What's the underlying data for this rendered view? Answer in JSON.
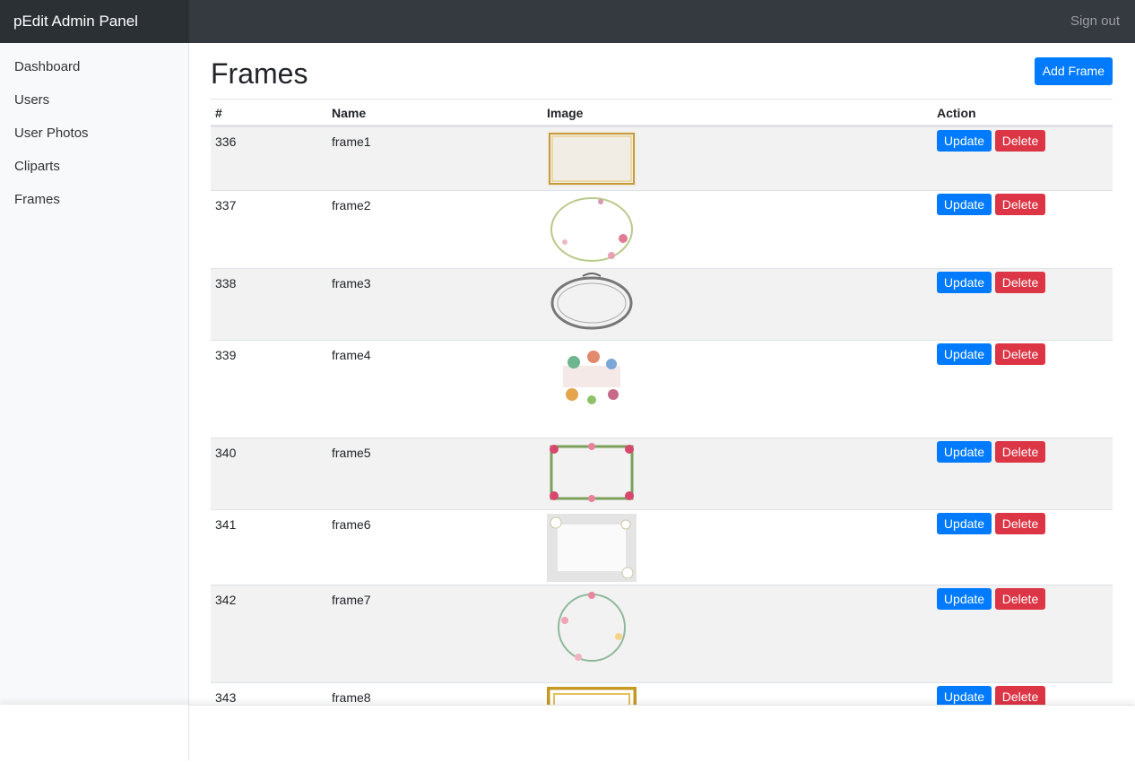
{
  "header": {
    "brand": "pEdit Admin Panel",
    "signout": "Sign out"
  },
  "sidebar": {
    "items": [
      {
        "label": "Dashboard"
      },
      {
        "label": "Users"
      },
      {
        "label": "User Photos"
      },
      {
        "label": "Cliparts"
      },
      {
        "label": "Frames"
      }
    ]
  },
  "page": {
    "title": "Frames",
    "add_button": "Add Frame"
  },
  "table": {
    "headers": [
      "#",
      "Name",
      "Image",
      "Action"
    ],
    "update_label": "Update",
    "delete_label": "Delete",
    "rows": [
      {
        "id": "336",
        "name": "frame1",
        "frame_style": "gold-rect"
      },
      {
        "id": "337",
        "name": "frame2",
        "frame_style": "floral-oval"
      },
      {
        "id": "338",
        "name": "frame3",
        "frame_style": "ornate-oval"
      },
      {
        "id": "339",
        "name": "frame4",
        "frame_style": "floral-bouquet"
      },
      {
        "id": "340",
        "name": "frame5",
        "frame_style": "rose-rect"
      },
      {
        "id": "341",
        "name": "frame6",
        "frame_style": "white-flowers"
      },
      {
        "id": "342",
        "name": "frame7",
        "frame_style": "floral-wreath"
      },
      {
        "id": "343",
        "name": "frame8",
        "frame_style": "gold-square"
      }
    ]
  },
  "colors": {
    "primary": "#007bff",
    "danger": "#dc3545",
    "topbar": "#343a40"
  }
}
